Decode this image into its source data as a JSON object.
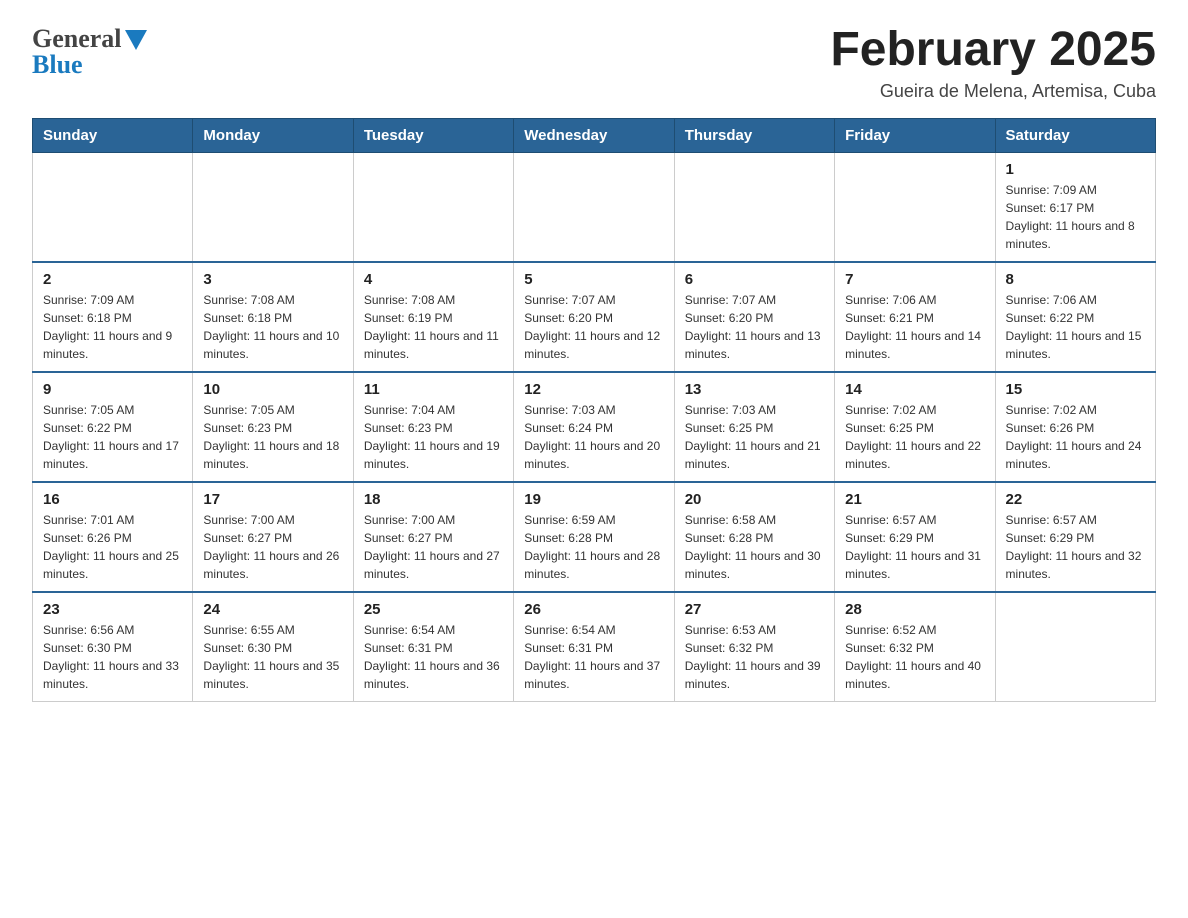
{
  "header": {
    "logo_line1": "General",
    "logo_line2": "Blue",
    "month_title": "February 2025",
    "location": "Gueira de Melena, Artemisa, Cuba"
  },
  "weekdays": [
    "Sunday",
    "Monday",
    "Tuesday",
    "Wednesday",
    "Thursday",
    "Friday",
    "Saturday"
  ],
  "weeks": [
    [
      {
        "day": "",
        "info": ""
      },
      {
        "day": "",
        "info": ""
      },
      {
        "day": "",
        "info": ""
      },
      {
        "day": "",
        "info": ""
      },
      {
        "day": "",
        "info": ""
      },
      {
        "day": "",
        "info": ""
      },
      {
        "day": "1",
        "info": "Sunrise: 7:09 AM\nSunset: 6:17 PM\nDaylight: 11 hours and 8 minutes."
      }
    ],
    [
      {
        "day": "2",
        "info": "Sunrise: 7:09 AM\nSunset: 6:18 PM\nDaylight: 11 hours and 9 minutes."
      },
      {
        "day": "3",
        "info": "Sunrise: 7:08 AM\nSunset: 6:18 PM\nDaylight: 11 hours and 10 minutes."
      },
      {
        "day": "4",
        "info": "Sunrise: 7:08 AM\nSunset: 6:19 PM\nDaylight: 11 hours and 11 minutes."
      },
      {
        "day": "5",
        "info": "Sunrise: 7:07 AM\nSunset: 6:20 PM\nDaylight: 11 hours and 12 minutes."
      },
      {
        "day": "6",
        "info": "Sunrise: 7:07 AM\nSunset: 6:20 PM\nDaylight: 11 hours and 13 minutes."
      },
      {
        "day": "7",
        "info": "Sunrise: 7:06 AM\nSunset: 6:21 PM\nDaylight: 11 hours and 14 minutes."
      },
      {
        "day": "8",
        "info": "Sunrise: 7:06 AM\nSunset: 6:22 PM\nDaylight: 11 hours and 15 minutes."
      }
    ],
    [
      {
        "day": "9",
        "info": "Sunrise: 7:05 AM\nSunset: 6:22 PM\nDaylight: 11 hours and 17 minutes."
      },
      {
        "day": "10",
        "info": "Sunrise: 7:05 AM\nSunset: 6:23 PM\nDaylight: 11 hours and 18 minutes."
      },
      {
        "day": "11",
        "info": "Sunrise: 7:04 AM\nSunset: 6:23 PM\nDaylight: 11 hours and 19 minutes."
      },
      {
        "day": "12",
        "info": "Sunrise: 7:03 AM\nSunset: 6:24 PM\nDaylight: 11 hours and 20 minutes."
      },
      {
        "day": "13",
        "info": "Sunrise: 7:03 AM\nSunset: 6:25 PM\nDaylight: 11 hours and 21 minutes."
      },
      {
        "day": "14",
        "info": "Sunrise: 7:02 AM\nSunset: 6:25 PM\nDaylight: 11 hours and 22 minutes."
      },
      {
        "day": "15",
        "info": "Sunrise: 7:02 AM\nSunset: 6:26 PM\nDaylight: 11 hours and 24 minutes."
      }
    ],
    [
      {
        "day": "16",
        "info": "Sunrise: 7:01 AM\nSunset: 6:26 PM\nDaylight: 11 hours and 25 minutes."
      },
      {
        "day": "17",
        "info": "Sunrise: 7:00 AM\nSunset: 6:27 PM\nDaylight: 11 hours and 26 minutes."
      },
      {
        "day": "18",
        "info": "Sunrise: 7:00 AM\nSunset: 6:27 PM\nDaylight: 11 hours and 27 minutes."
      },
      {
        "day": "19",
        "info": "Sunrise: 6:59 AM\nSunset: 6:28 PM\nDaylight: 11 hours and 28 minutes."
      },
      {
        "day": "20",
        "info": "Sunrise: 6:58 AM\nSunset: 6:28 PM\nDaylight: 11 hours and 30 minutes."
      },
      {
        "day": "21",
        "info": "Sunrise: 6:57 AM\nSunset: 6:29 PM\nDaylight: 11 hours and 31 minutes."
      },
      {
        "day": "22",
        "info": "Sunrise: 6:57 AM\nSunset: 6:29 PM\nDaylight: 11 hours and 32 minutes."
      }
    ],
    [
      {
        "day": "23",
        "info": "Sunrise: 6:56 AM\nSunset: 6:30 PM\nDaylight: 11 hours and 33 minutes."
      },
      {
        "day": "24",
        "info": "Sunrise: 6:55 AM\nSunset: 6:30 PM\nDaylight: 11 hours and 35 minutes."
      },
      {
        "day": "25",
        "info": "Sunrise: 6:54 AM\nSunset: 6:31 PM\nDaylight: 11 hours and 36 minutes."
      },
      {
        "day": "26",
        "info": "Sunrise: 6:54 AM\nSunset: 6:31 PM\nDaylight: 11 hours and 37 minutes."
      },
      {
        "day": "27",
        "info": "Sunrise: 6:53 AM\nSunset: 6:32 PM\nDaylight: 11 hours and 39 minutes."
      },
      {
        "day": "28",
        "info": "Sunrise: 6:52 AM\nSunset: 6:32 PM\nDaylight: 11 hours and 40 minutes."
      },
      {
        "day": "",
        "info": ""
      }
    ]
  ]
}
